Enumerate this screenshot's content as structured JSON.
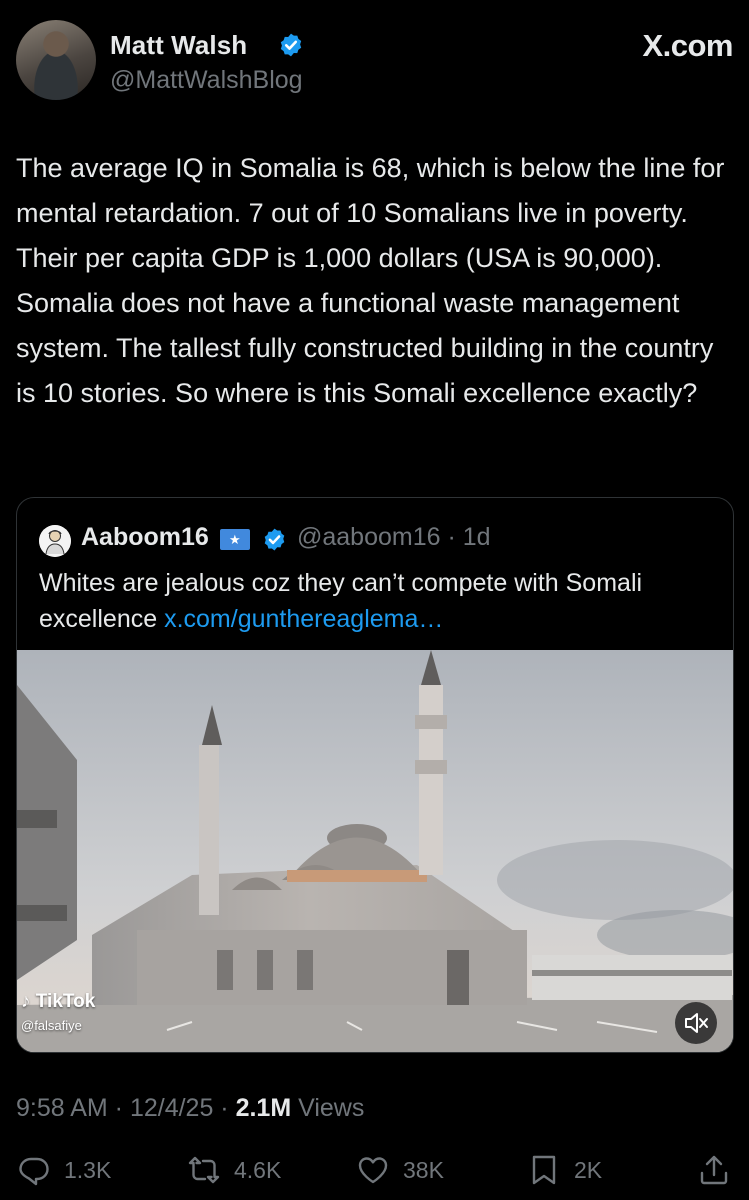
{
  "author": {
    "name": "Matt Walsh",
    "handle": "@MattWalshBlog",
    "verified_icon": "verified-badge-icon"
  },
  "brand": {
    "label": "X.com"
  },
  "tweet": {
    "text": "The average IQ in Somalia is 68, which is below the line for mental retardation. 7 out of 10 Somalians live in poverty. Their per capita GDP is 1,000 dollars (USA is 90,000). Somalia does not have a functional waste management system. The tallest fully constructed building in the country is 10 stories. So where is this Somali excellence exactly?"
  },
  "quote": {
    "name": "Aaboom16",
    "flag_icon": "somalia-flag-icon",
    "handle_time": "@aaboom16 · 1d",
    "text": "Whites are jealous coz they can’t compete with Somali excellence ",
    "link": "x.com/gunthereaglema…",
    "media": {
      "watermark_brand": "TikTok",
      "watermark_handle": "@falsafiye",
      "mute_icon": "muted-speaker-icon"
    }
  },
  "meta": {
    "time_date": "9:58 AM · 12/4/25 · ",
    "views_count": "2.1M",
    "views_label": " Views"
  },
  "actions": {
    "replies": "1.3K",
    "reposts": "4.6K",
    "likes": "38K",
    "bookmarks": "2K"
  },
  "colors": {
    "background": "#000000",
    "text": "#e7e9ea",
    "secondary": "#71767b",
    "link": "#1d9bf0",
    "verified": "#1d9bf0",
    "border": "#2f3336"
  }
}
